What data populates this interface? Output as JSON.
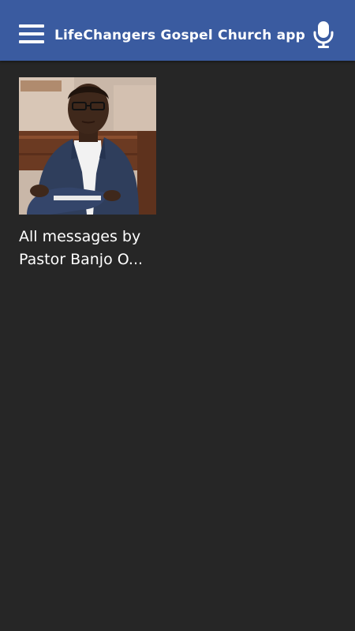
{
  "appbar": {
    "title": "LifeChangers Gospel Church app",
    "menu_icon": "hamburger-menu-icon",
    "mic_icon": "microphone-icon",
    "color": "#3a5ba0"
  },
  "content": {
    "background": "#262626",
    "items": [
      {
        "title": "All messages by Pastor Banjo O...",
        "image": "pastor-portrait-photo"
      }
    ]
  }
}
